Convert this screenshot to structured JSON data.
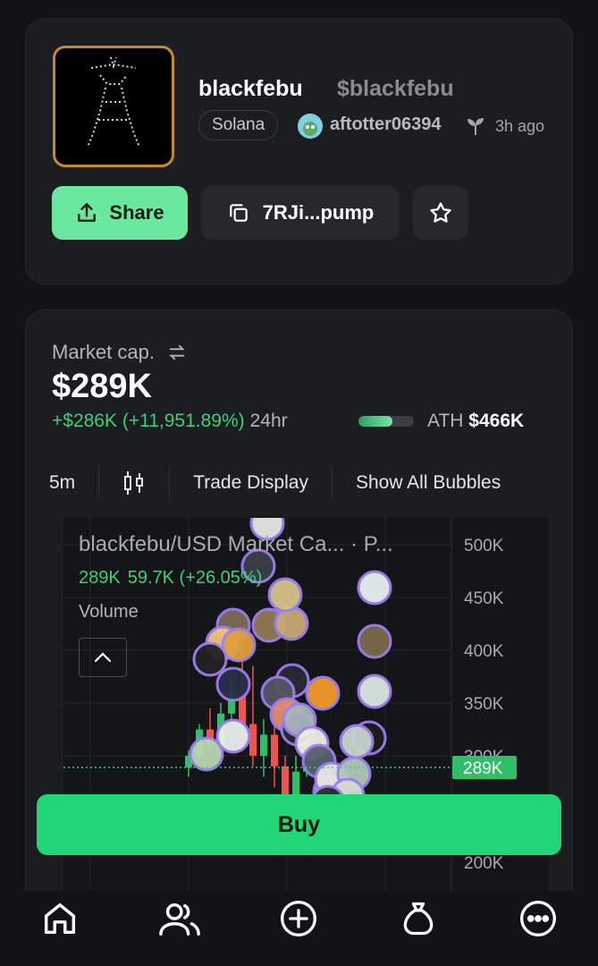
{
  "token": {
    "name": "blackfebu",
    "ticker": "$blackfebu",
    "chain": "Solana",
    "creator": "aftotter06394",
    "age": "3h ago",
    "share_label": "Share",
    "contract_short": "7RJi...pump"
  },
  "market": {
    "label": "Market cap.",
    "value": "$289K",
    "change": "+$286K (+11,951.89%)",
    "period": "24hr",
    "ath_label": "ATH",
    "ath_value": "$466K",
    "ath_progress": 0.62
  },
  "toolbar": {
    "interval": "5m",
    "trade_display": "Trade Display",
    "show_all_bubbles": "Show All Bubbles"
  },
  "chart": {
    "title": "blackfebu/USD Market Ca... · P...",
    "ohlc_last": "289K",
    "ohlc_change": "59.7K (+26.05%)",
    "volume_label": "Volume",
    "price_tag": "289K",
    "colors": {
      "up": "#2fbf6b",
      "down": "#ef5350",
      "bubble_ring": "#9d7ff0",
      "grid": "#25272b"
    }
  },
  "chart_data": {
    "type": "candlestick",
    "y_ticks": [
      "500K",
      "450K",
      "400K",
      "350K",
      "300K",
      "200K"
    ],
    "ylim": [
      200,
      510
    ],
    "current_value": 289,
    "candles": [
      {
        "o": 289,
        "c": 300,
        "h": 305,
        "l": 280
      },
      {
        "o": 300,
        "c": 325,
        "h": 330,
        "l": 295
      },
      {
        "o": 325,
        "c": 310,
        "h": 345,
        "l": 305
      },
      {
        "o": 310,
        "c": 340,
        "h": 350,
        "l": 300
      },
      {
        "o": 340,
        "c": 360,
        "h": 372,
        "l": 330
      },
      {
        "o": 360,
        "c": 330,
        "h": 398,
        "l": 320
      },
      {
        "o": 330,
        "c": 300,
        "h": 385,
        "l": 290
      },
      {
        "o": 300,
        "c": 320,
        "h": 335,
        "l": 280
      },
      {
        "o": 320,
        "c": 290,
        "h": 330,
        "l": 270
      },
      {
        "o": 290,
        "c": 260,
        "h": 300,
        "l": 250
      },
      {
        "o": 260,
        "c": 285,
        "h": 300,
        "l": 255
      },
      {
        "o": 285,
        "c": 289,
        "h": 310,
        "l": 280
      }
    ]
  },
  "buy_label": "Buy",
  "nav": {
    "items": [
      "home",
      "community",
      "create",
      "rewards",
      "more"
    ]
  }
}
